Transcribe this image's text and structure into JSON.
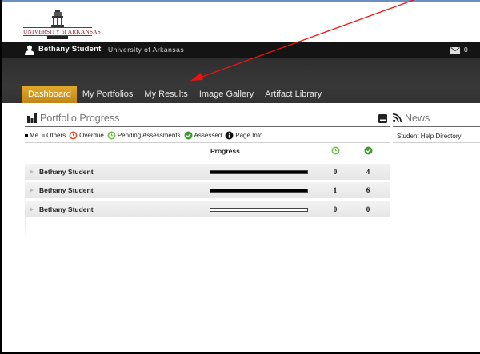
{
  "header": {
    "logo_text": "UNIVERSITY of ARKANSAS"
  },
  "user_bar": {
    "user_name": "Bethany Student",
    "organization": "University of Arkansas",
    "message_count": "0"
  },
  "nav": {
    "tabs": [
      {
        "label": "Dashboard",
        "active": true
      },
      {
        "label": "My Portfolios",
        "active": false
      },
      {
        "label": "My Results",
        "active": false
      },
      {
        "label": "Image Gallery",
        "active": false
      },
      {
        "label": "Artifact Library",
        "active": false
      }
    ]
  },
  "portfolio": {
    "title": "Portfolio Progress",
    "legend": {
      "me": "Me",
      "others": "Others",
      "overdue": "Overdue",
      "pending": "Pending Assessments",
      "assessed": "Assessed",
      "page_info": "Page Info"
    },
    "table": {
      "progress_header": "Progress",
      "rows": [
        {
          "name": "Bethany Student",
          "progress": 1.0,
          "pending": "0",
          "assessed": "4"
        },
        {
          "name": "Bethany Student",
          "progress": 1.0,
          "pending": "1",
          "assessed": "6"
        },
        {
          "name": "Bethany Student",
          "progress": 0.0,
          "pending": "0",
          "assessed": "0"
        }
      ]
    }
  },
  "news": {
    "title": "News",
    "links": [
      "Student Help Directory"
    ]
  },
  "colors": {
    "nav_active": "#d49a22",
    "user_bar": "#141414",
    "annotation_arrow": "#ee1111",
    "overdue": "#e0532b",
    "pending": "#6cc24a",
    "assessed": "#3f9a2e"
  }
}
